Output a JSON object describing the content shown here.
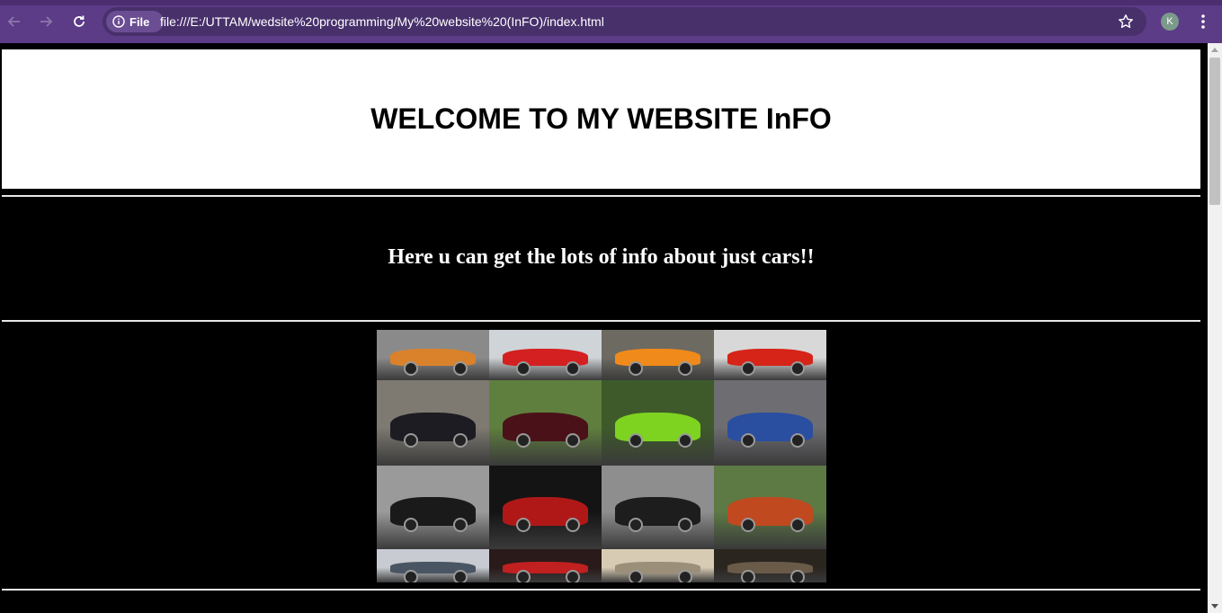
{
  "browser": {
    "site_chip_label": "File",
    "url": "file:///E:/UTTAM/wedsite%20programming/My%20website%20(InFO)/index.html",
    "profile_initial": "K",
    "icons": [
      "back-arrow-icon",
      "forward-arrow-icon",
      "reload-icon",
      "info-icon",
      "star-icon",
      "kebab-menu-icon"
    ]
  },
  "page": {
    "heading": "WELCOME TO MY WEBSITE InFO",
    "tagline": "Here u can get the lots of info about just cars!!",
    "gallery": {
      "tiles": [
        {
          "name": "orange-supercar",
          "bg": "#8a8a8a",
          "car": "#d9822b"
        },
        {
          "name": "red-ferrari-f40",
          "bg": "#cfd4d8",
          "car": "#d42020"
        },
        {
          "name": "orange-lamborghini",
          "bg": "#6d6a62",
          "car": "#f08a1a"
        },
        {
          "name": "red-ferrari-488",
          "bg": "#d8d8d8",
          "car": "#d62418"
        },
        {
          "name": "black-jaguar",
          "bg": "#7e7a72",
          "car": "#1c1c22"
        },
        {
          "name": "maroon-lamborghini",
          "bg": "#5f7f3e",
          "car": "#4a1218"
        },
        {
          "name": "green-mclaren",
          "bg": "#3e5a2a",
          "car": "#7ed321"
        },
        {
          "name": "audi-r8-pair",
          "bg": "#6e6e72",
          "car": "#2a4fa0"
        },
        {
          "name": "black-mclaren-p1",
          "bg": "#9a9a9a",
          "car": "#1a1a1a"
        },
        {
          "name": "black-red-koenigsegg",
          "bg": "#141414",
          "car": "#b01818"
        },
        {
          "name": "black-mclaren-720",
          "bg": "#8e8e8e",
          "car": "#1d1d1d"
        },
        {
          "name": "bugatti-veyron",
          "bg": "#5d7a45",
          "car": "#c0491f"
        },
        {
          "name": "grandstand",
          "bg": "#c8ccd2",
          "car": "#4a5563"
        },
        {
          "name": "red-car-show",
          "bg": "#2a1a1a",
          "car": "#c02020"
        },
        {
          "name": "beige-blur",
          "bg": "#d8cbb4",
          "car": "#9b8f7a"
        },
        {
          "name": "dark-blur",
          "bg": "#2b2520",
          "car": "#6a5a48"
        }
      ]
    }
  },
  "colors": {
    "chrome": "#5c3b87",
    "omnibox": "#48306b",
    "page_background": "#000000",
    "header_background": "#ffffff"
  }
}
